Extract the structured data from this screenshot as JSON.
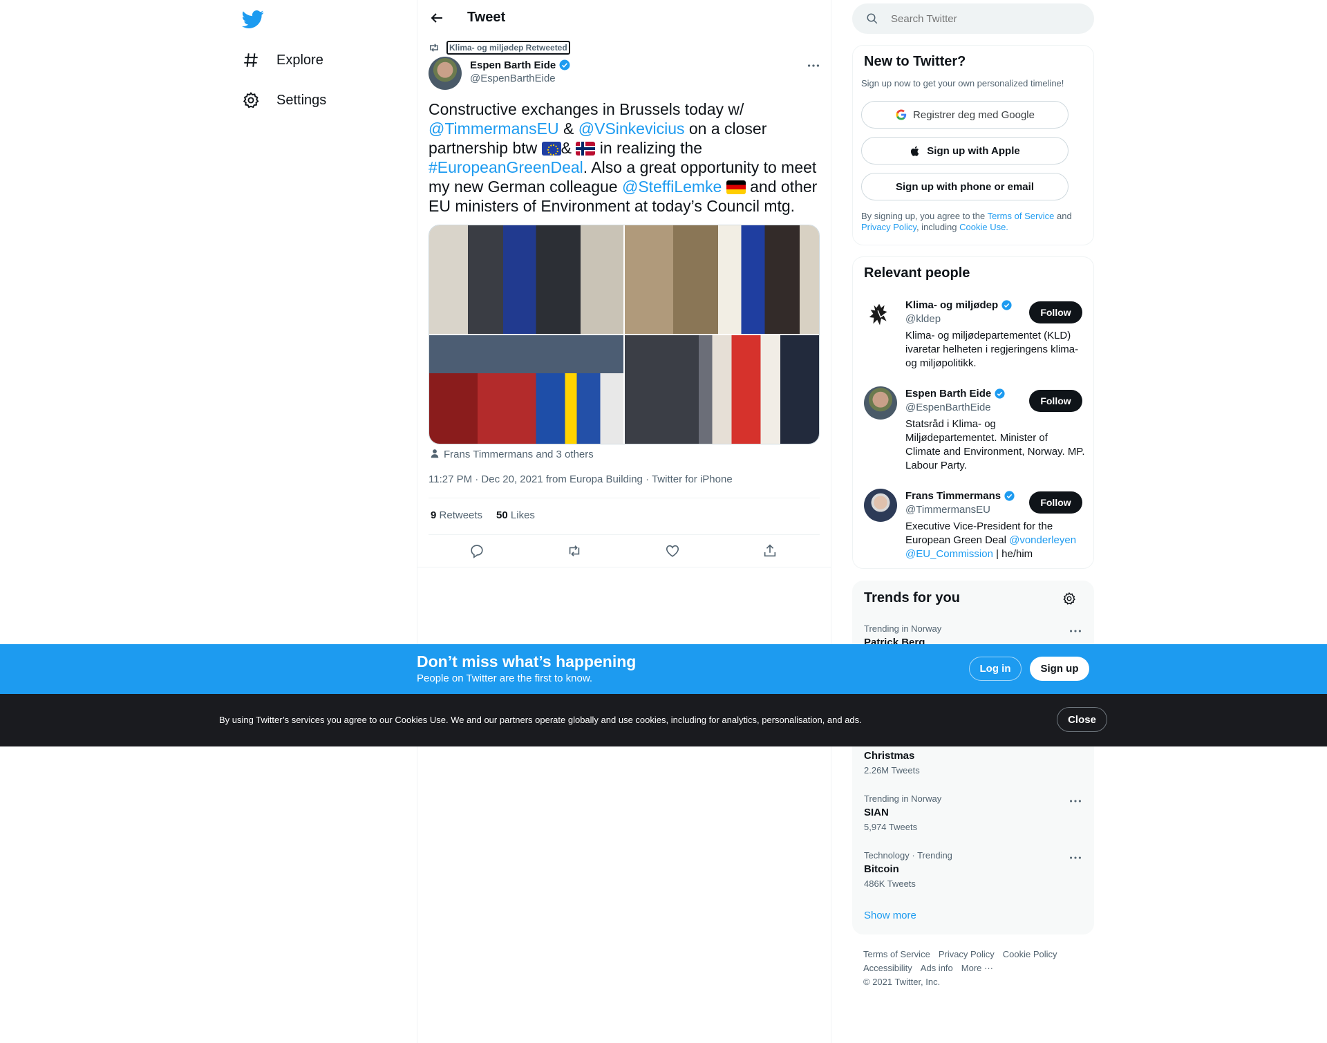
{
  "nav": {
    "explore": "Explore",
    "settings": "Settings"
  },
  "header": {
    "title": "Tweet"
  },
  "tweet": {
    "retweeted_by": "Klima- og miljødep Retweeted",
    "author_name": "Espen Barth Eide",
    "author_handle": "@EspenBarthEide",
    "text": {
      "t1": "Constructive exchanges in Brussels today w/ ",
      "m1": "@TimmermansEU",
      "t2": " & ",
      "m2": "@VSinkevicius",
      "t3": " on a closer partnership btw ",
      "t4": "& ",
      "t5": " in realizing the ",
      "h1": "#EuropeanGreenDeal",
      "t6": ". Also a great opportunity to meet my new German colleague ",
      "m3": "@SteffiLemke",
      "t7": " and other EU ministers of Environment at today’s Council mtg."
    },
    "tagged": "Frans Timmermans and 3 others",
    "timestamp": "11:27 PM · Dec 20, 2021 from Europa Building · Twitter for iPhone",
    "retweets_count": "9",
    "retweets_label": "Retweets",
    "likes_count": "50",
    "likes_label": "Likes"
  },
  "search": {
    "placeholder": "Search Twitter"
  },
  "new_to_twitter": {
    "title": "New to Twitter?",
    "subtitle": "Sign up now to get your own personalized timeline!",
    "google": "Registrer deg med Google",
    "apple": "Sign up with Apple",
    "phone": "Sign up with phone or email",
    "legal_1": "By signing up, you agree to the ",
    "terms": "Terms of Service",
    "legal_2": " and ",
    "privacy": "Privacy Policy",
    "legal_3": ", including ",
    "cookie": "Cookie Use."
  },
  "relevant_people": {
    "title": "Relevant people",
    "follow_label": "Follow",
    "people": [
      {
        "name": "Klima- og miljødep",
        "handle": "@kldep",
        "bio": "Klima- og miljødepartementet (KLD) ivaretar helheten i regjeringens klima- og miljøpolitikk."
      },
      {
        "name": "Espen Barth Eide",
        "handle": "@EspenBarthEide",
        "bio": "Statsråd i Klima- og Miljødepartementet. Minister of Climate and Environment, Norway. MP. Labour Party."
      },
      {
        "name": "Frans Timmermans",
        "handle": "@TimmermansEU",
        "bio_1": "Executive Vice-President for the European Green Deal ",
        "bio_m1": "@vonderleyen",
        "bio_m2": "@EU_Commission",
        "bio_2": " | he/him"
      }
    ]
  },
  "trends": {
    "title": "Trends for you",
    "items": [
      {
        "meta": "Trending in Norway",
        "name": "Patrick Berg"
      },
      {
        "name": "Christmas",
        "count": "2.26M Tweets"
      },
      {
        "meta": "Trending in Norway",
        "name": "SIAN",
        "count": "5,974 Tweets"
      },
      {
        "meta": "Technology · Trending",
        "name": "Bitcoin",
        "count": "486K Tweets"
      }
    ],
    "show_more": "Show more"
  },
  "footer": {
    "terms": "Terms of Service",
    "privacy": "Privacy Policy",
    "cookie": "Cookie Policy",
    "accessibility": "Accessibility",
    "ads": "Ads info",
    "more": "More ···",
    "copyright": "© 2021 Twitter, Inc."
  },
  "promo": {
    "title": "Don’t miss what’s happening",
    "subtitle": "People on Twitter are the first to know.",
    "login": "Log in",
    "signup": "Sign up"
  },
  "cookie_banner": {
    "text": "By using Twitter’s services you agree to our Cookies Use. We and our partners operate globally and use cookies, including for analytics, personalisation, and ads.",
    "close": "Close"
  },
  "colors": {
    "accent": "#1d9bf0",
    "verified": "#1d9bf0",
    "cookie_bg": "#1a1b1f"
  },
  "icons": [
    "twitter-logo-icon",
    "hashtag-icon",
    "gear-icon",
    "back-arrow-icon",
    "retweet-icon",
    "verified-icon",
    "more-icon",
    "reply-icon",
    "like-icon",
    "share-icon",
    "search-icon",
    "google-icon",
    "apple-icon",
    "person-icon"
  ]
}
